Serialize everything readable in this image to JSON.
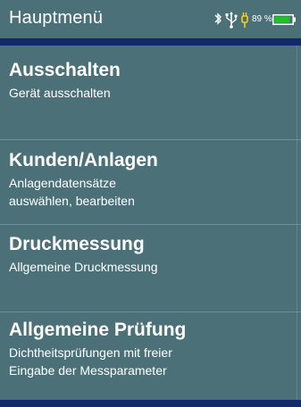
{
  "header": {
    "title": "Hauptmenü",
    "battery_percent": "89 %",
    "battery_level": 0.89,
    "icons": [
      "bluetooth-icon",
      "usb-icon",
      "plug-icon",
      "battery-icon"
    ],
    "battery_color": "#1dc41d",
    "accent_bar_color": "#122a6a",
    "background_color": "#4b7078"
  },
  "menu": {
    "items": [
      {
        "title": "Ausschalten",
        "desc_line1": "Gerät ausschalten",
        "desc_line2": ""
      },
      {
        "title": "Kunden/Anlagen",
        "desc_line1": "Anlagendatensätze",
        "desc_line2": "auswählen, bearbeiten"
      },
      {
        "title": "Druckmessung",
        "desc_line1": "Allgemeine Druckmessung",
        "desc_line2": ""
      },
      {
        "title": "Allgemeine Prüfung",
        "desc_line1": "Dichtheitsprüfungen mit freier",
        "desc_line2": "Eingabe der Messparameter"
      }
    ]
  }
}
